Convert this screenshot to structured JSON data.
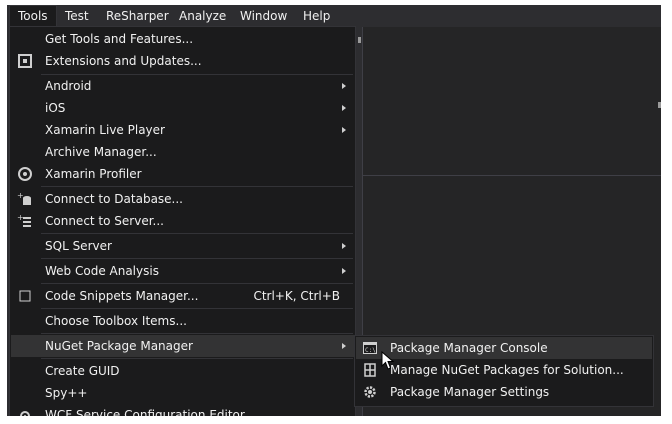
{
  "menubar": [
    "Tools",
    "Test",
    "ReSharper",
    "Analyze",
    "Window",
    "Help"
  ],
  "tools_menu": {
    "get_tools": "Get Tools and Features...",
    "extensions": "Extensions and Updates...",
    "android": "Android",
    "ios": "iOS",
    "xamarin_live_player": "Xamarin Live Player",
    "archive_manager": "Archive Manager...",
    "xamarin_profiler": "Xamarin Profiler",
    "connect_database": "Connect to Database...",
    "connect_server": "Connect to Server...",
    "sql_server": "SQL Server",
    "web_code_analysis": "Web Code Analysis",
    "code_snippets": "Code Snippets Manager...",
    "code_snippets_shortcut": "Ctrl+K, Ctrl+B",
    "choose_toolbox": "Choose Toolbox Items...",
    "nuget": "NuGet Package Manager",
    "create_guid": "Create GUID",
    "spy": "Spy++",
    "wcf": "WCF Service Configuration Editor"
  },
  "nuget_submenu": {
    "console": "Package Manager Console",
    "manage": "Manage NuGet Packages for Solution...",
    "settings": "Package Manager Settings"
  },
  "icons": {
    "extensions": "extensions-icon",
    "xamarin_profiler": "profiler-icon",
    "connect_database": "database-icon",
    "connect_server": "server-icon",
    "code_snippets": "checkbox-icon",
    "wcf": "gear-icon",
    "console": "console-icon",
    "manage": "nuget-packages-icon",
    "settings": "gear-icon"
  },
  "colors": {
    "menu_bg": "#1b1b1c",
    "chrome_bg": "#2d2d30",
    "highlight": "#333334",
    "text": "#f1f1f1"
  }
}
